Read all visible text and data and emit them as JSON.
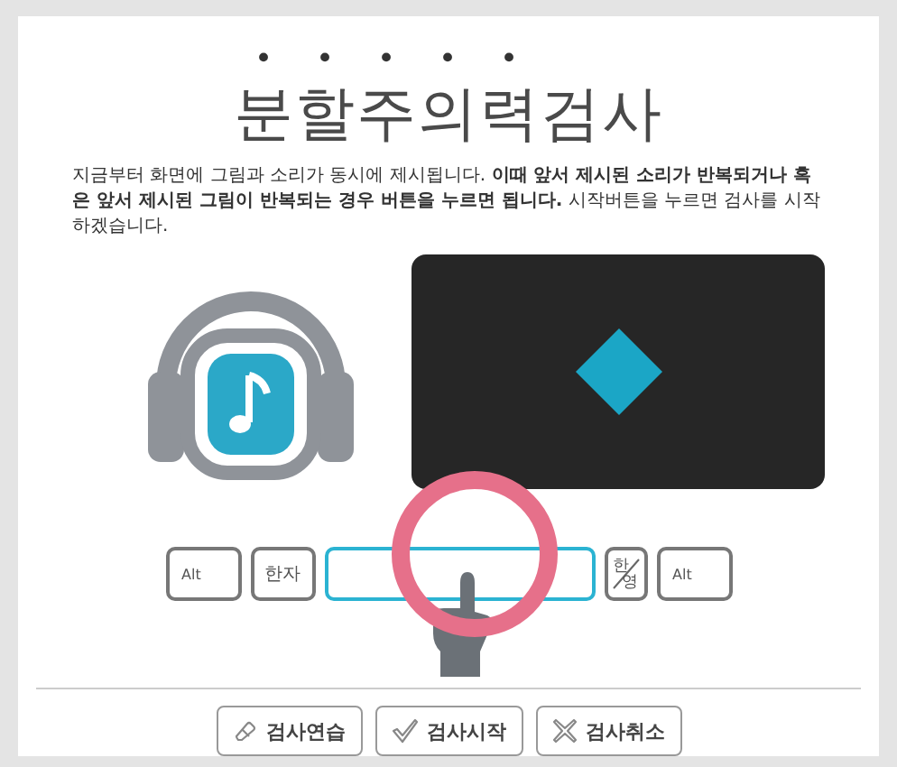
{
  "title": {
    "dotted": "분할주의력",
    "rest": "검사"
  },
  "instructions": "지금부터 화면에 그림과 소리가 동시에 제시됩니다. **이때 앞서 제시된 소리가 반복되거나 혹은 앞서 제시된 그림이 반복되는 경우 버튼을 누르면 됩니다.** 시작버튼을 누르면 검사를 시작하겠습니다.",
  "keys": [
    {
      "kind": "key",
      "label": "Alt"
    },
    {
      "kind": "key",
      "label": "한자"
    },
    {
      "kind": "space"
    },
    {
      "kind": "split",
      "top": "한",
      "bottom": "영"
    },
    {
      "kind": "key",
      "label": "Alt"
    }
  ],
  "buttons": [
    {
      "kind": "practice",
      "label": "검사연습"
    },
    {
      "kind": "start",
      "label": "검사시작"
    },
    {
      "kind": "cancel",
      "label": "검사취소"
    }
  ]
}
